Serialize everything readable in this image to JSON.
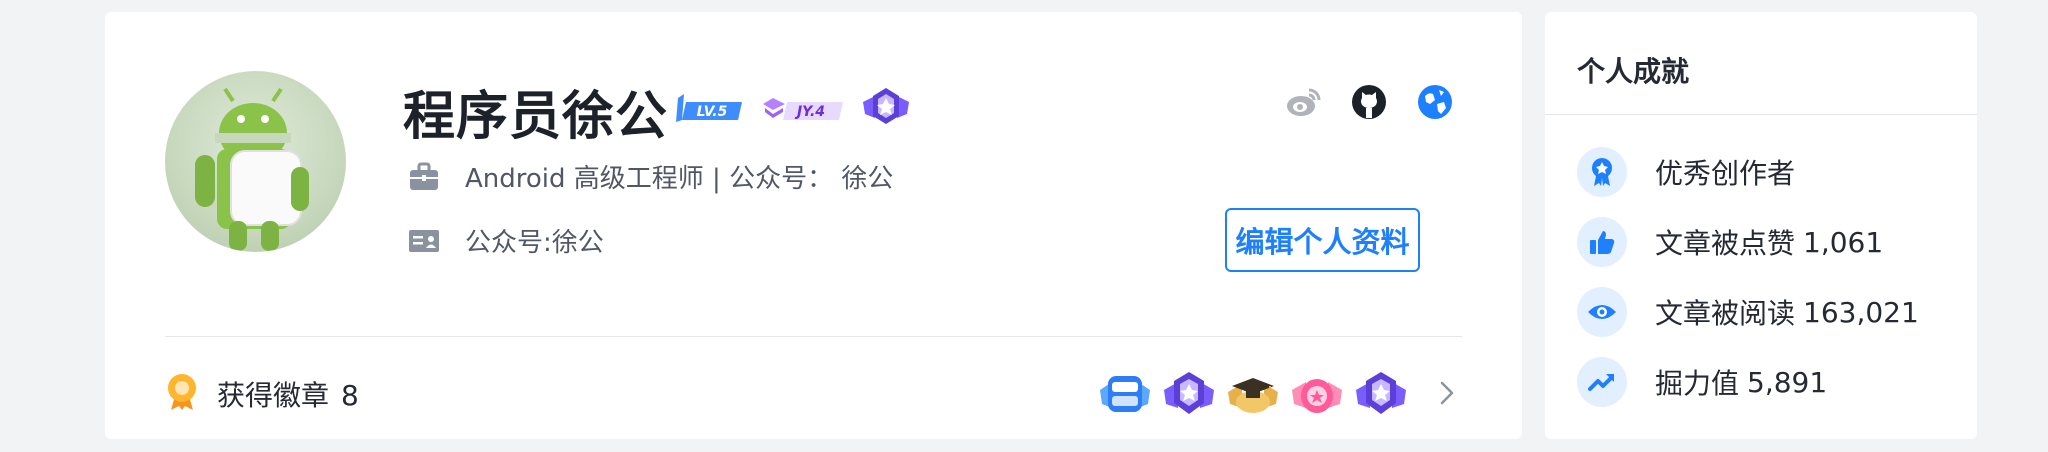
{
  "profile": {
    "username": "程序员徐公",
    "level_badge": "LV.5",
    "jy_badge": "JY.4",
    "job": "Android 高级工程师 | 公众号： 徐公",
    "bio": "公众号:徐公",
    "edit_button": "编辑个人资料",
    "social_icons": [
      "weibo-icon",
      "github-icon",
      "globe-icon"
    ]
  },
  "medals": {
    "label": "获得徽章",
    "count": "8",
    "icons": [
      "medal-1",
      "medal-2",
      "medal-3",
      "medal-4",
      "medal-5"
    ]
  },
  "achievements": {
    "title": "个人成就",
    "items": [
      {
        "label": "优秀创作者",
        "value": "",
        "icon": "award-icon"
      },
      {
        "label": "文章被点赞",
        "value": "1,061",
        "icon": "thumbs-up-icon"
      },
      {
        "label": "文章被阅读",
        "value": "163,021",
        "icon": "eye-icon"
      },
      {
        "label": "掘力值",
        "value": "5,891",
        "icon": "trend-up-icon"
      }
    ]
  },
  "colors": {
    "accent": "#1e80ff",
    "background": "#f2f3f5",
    "card": "#ffffff",
    "text": "#252933",
    "muted": "#515767"
  }
}
